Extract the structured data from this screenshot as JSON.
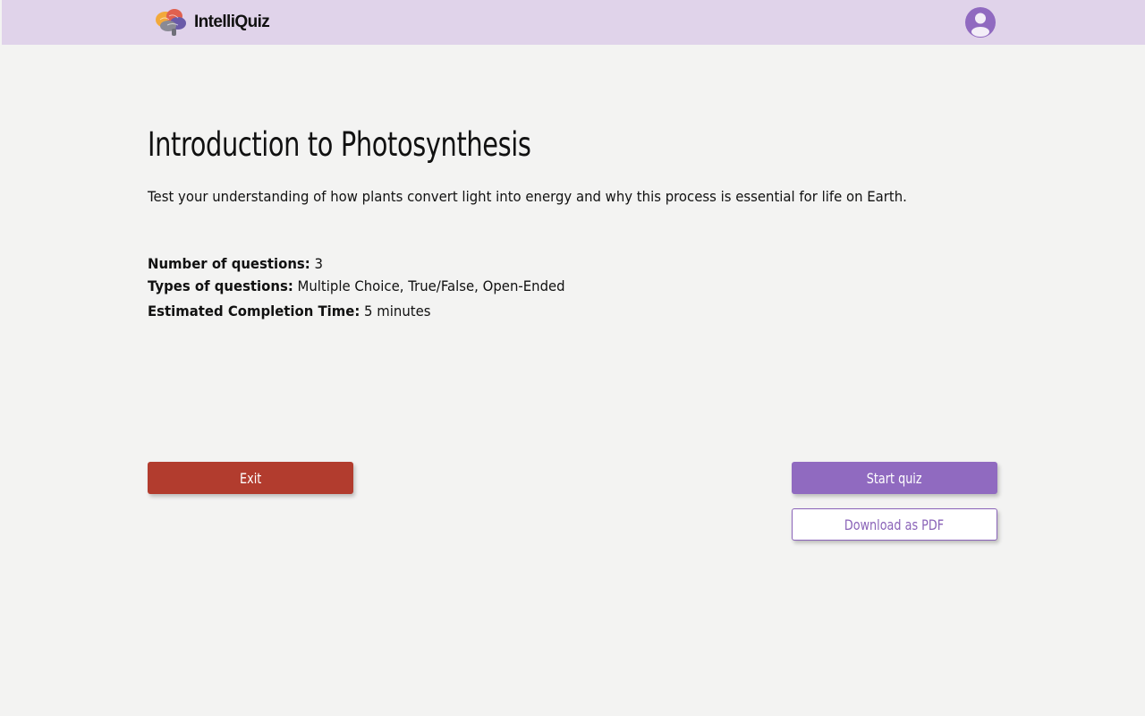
{
  "app": {
    "name": "IntelliQuiz"
  },
  "quiz": {
    "title": "Introduction to Photosynthesis",
    "description": "Test your understanding of how plants convert light into energy and why this process is essential for life on Earth.",
    "details": [
      {
        "label": "Number of questions:",
        "value": "3"
      },
      {
        "label": "Types of questions:",
        "value": "Multiple Choice, True/False, Open-Ended"
      },
      {
        "label": "Estimated Completion Time:",
        "value": "5 minutes"
      }
    ]
  },
  "actions": {
    "exit_label": "Exit",
    "start_label": "Start quiz",
    "pdf_label": "Download as PDF"
  },
  "colors": {
    "header_bg": "#e0d3ea",
    "accent": "#906ac0",
    "exit": "#b23c2e",
    "background": "#f3f3f2"
  },
  "icons": {
    "logo": "brain-logo-icon",
    "user": "user-avatar-icon"
  }
}
